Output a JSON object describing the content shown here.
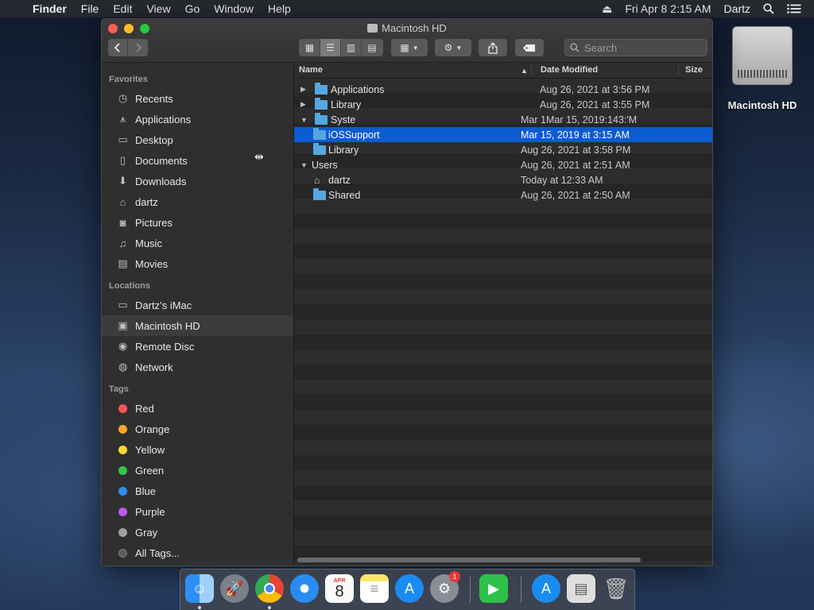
{
  "menubar": {
    "apple": "",
    "app": "Finder",
    "items": [
      "File",
      "Edit",
      "View",
      "Go",
      "Window",
      "Help"
    ],
    "eject": "⏏",
    "datetime": "Fri Apr 8  2:15 AM",
    "user": "Dartz"
  },
  "window": {
    "title": "Macintosh HD",
    "search_placeholder": "Search",
    "traffic": {
      "close": "#fe5f57",
      "minimize": "#febc2e",
      "zoom": "#28c840"
    }
  },
  "sidebar": {
    "favorites_label": "Favorites",
    "favorites": [
      {
        "label": "Recents",
        "icon": "clock-icon"
      },
      {
        "label": "Applications",
        "icon": "applications-icon"
      },
      {
        "label": "Desktop",
        "icon": "desktop-icon"
      },
      {
        "label": "Documents",
        "icon": "documents-icon"
      },
      {
        "label": "Downloads",
        "icon": "downloads-icon"
      },
      {
        "label": "dartz",
        "icon": "home-icon"
      },
      {
        "label": "Pictures",
        "icon": "camera-icon"
      },
      {
        "label": "Music",
        "icon": "music-icon"
      },
      {
        "label": "Movies",
        "icon": "film-icon"
      }
    ],
    "locations_label": "Locations",
    "locations": [
      {
        "label": "Dartz’s iMac",
        "icon": "imac-icon"
      },
      {
        "label": "Macintosh HD",
        "icon": "disk-icon",
        "selected": true
      },
      {
        "label": "Remote Disc",
        "icon": "disc-icon"
      },
      {
        "label": "Network",
        "icon": "globe-icon"
      }
    ],
    "tags_label": "Tags",
    "tags": [
      {
        "label": "Red",
        "color": "#fc5753"
      },
      {
        "label": "Orange",
        "color": "#fda429"
      },
      {
        "label": "Yellow",
        "color": "#fed731"
      },
      {
        "label": "Green",
        "color": "#33c748"
      },
      {
        "label": "Blue",
        "color": "#2f8cf6"
      },
      {
        "label": "Purple",
        "color": "#bf5af2"
      },
      {
        "label": "Gray",
        "color": "#a0a0a0"
      },
      {
        "label": "All Tags...",
        "color": "#5c5c5c"
      }
    ]
  },
  "columns": {
    "name": "Name",
    "date": "Date Modified",
    "size": "Size"
  },
  "rows": [
    {
      "name": "Applications",
      "date": "Aug 26, 2021 at 3:56 PM",
      "indent": 0,
      "tri": "▶",
      "date_offset": true
    },
    {
      "name": "Library",
      "date": "Aug 26, 2021 at 3:55 PM",
      "indent": 0,
      "tri": "▶",
      "date_offset": true
    },
    {
      "name": "Syste",
      "date": "Mar 1Mar 15, 2019:143:'M",
      "indent": 0,
      "tri": "▼"
    },
    {
      "name": "iOSSupport",
      "date": "Mar 15, 2019 at 3:15 AM",
      "indent": 1,
      "selected": true
    },
    {
      "name": "Library",
      "date": "Aug 26, 2021 at 3:58 PM",
      "indent": 1
    },
    {
      "name": "Users",
      "date": "Aug 26, 2021 at 2:51 AM",
      "indent": 0,
      "tri": "▼"
    },
    {
      "name": "dartz",
      "date": "Today at 12:33 AM",
      "indent": 1,
      "home": true
    },
    {
      "name": "Shared",
      "date": "Aug 26, 2021 at 2:50 AM",
      "indent": 1
    }
  ],
  "desktop": {
    "icon_label": "Macintosh HD"
  },
  "dock": {
    "calendar_month": "APR",
    "calendar_day": "8",
    "badge": "1"
  }
}
